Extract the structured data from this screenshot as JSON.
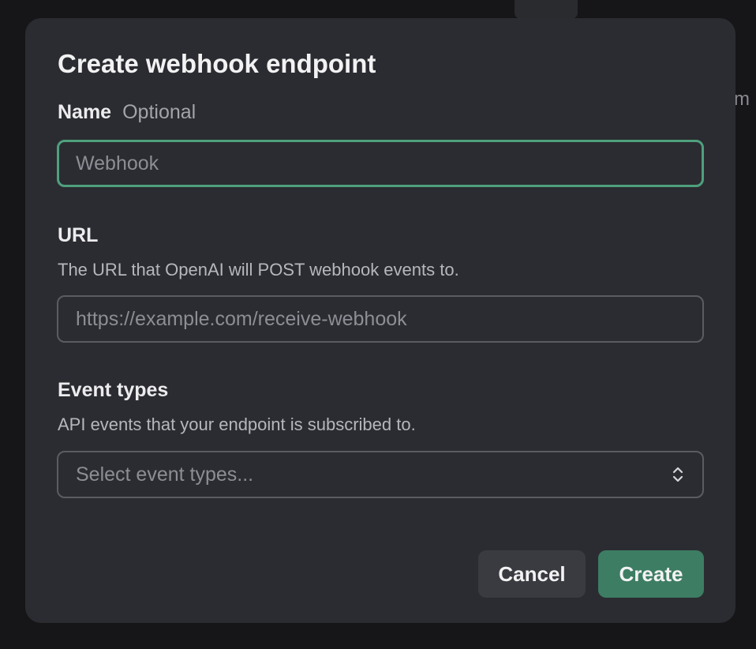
{
  "modal": {
    "title": "Create webhook endpoint",
    "name_field": {
      "label": "Name",
      "optional_text": "Optional",
      "placeholder": "Webhook",
      "value": ""
    },
    "url_field": {
      "label": "URL",
      "help_text": "The URL that OpenAI will POST webhook events to.",
      "placeholder": "https://example.com/receive-webhook",
      "value": ""
    },
    "event_types_field": {
      "label": "Event types",
      "help_text": "API events that your endpoint is subscribed to.",
      "placeholder": "Select event types..."
    },
    "buttons": {
      "cancel_label": "Cancel",
      "create_label": "Create"
    }
  },
  "background": {
    "partial_text": "m"
  },
  "colors": {
    "modal_bg": "#2b2c31",
    "focus_border": "#4fa07e",
    "primary_button": "#3d7d63",
    "secondary_button": "#3a3b41"
  },
  "icons": {
    "select_chevrons": "chevron-up-down-icon"
  }
}
